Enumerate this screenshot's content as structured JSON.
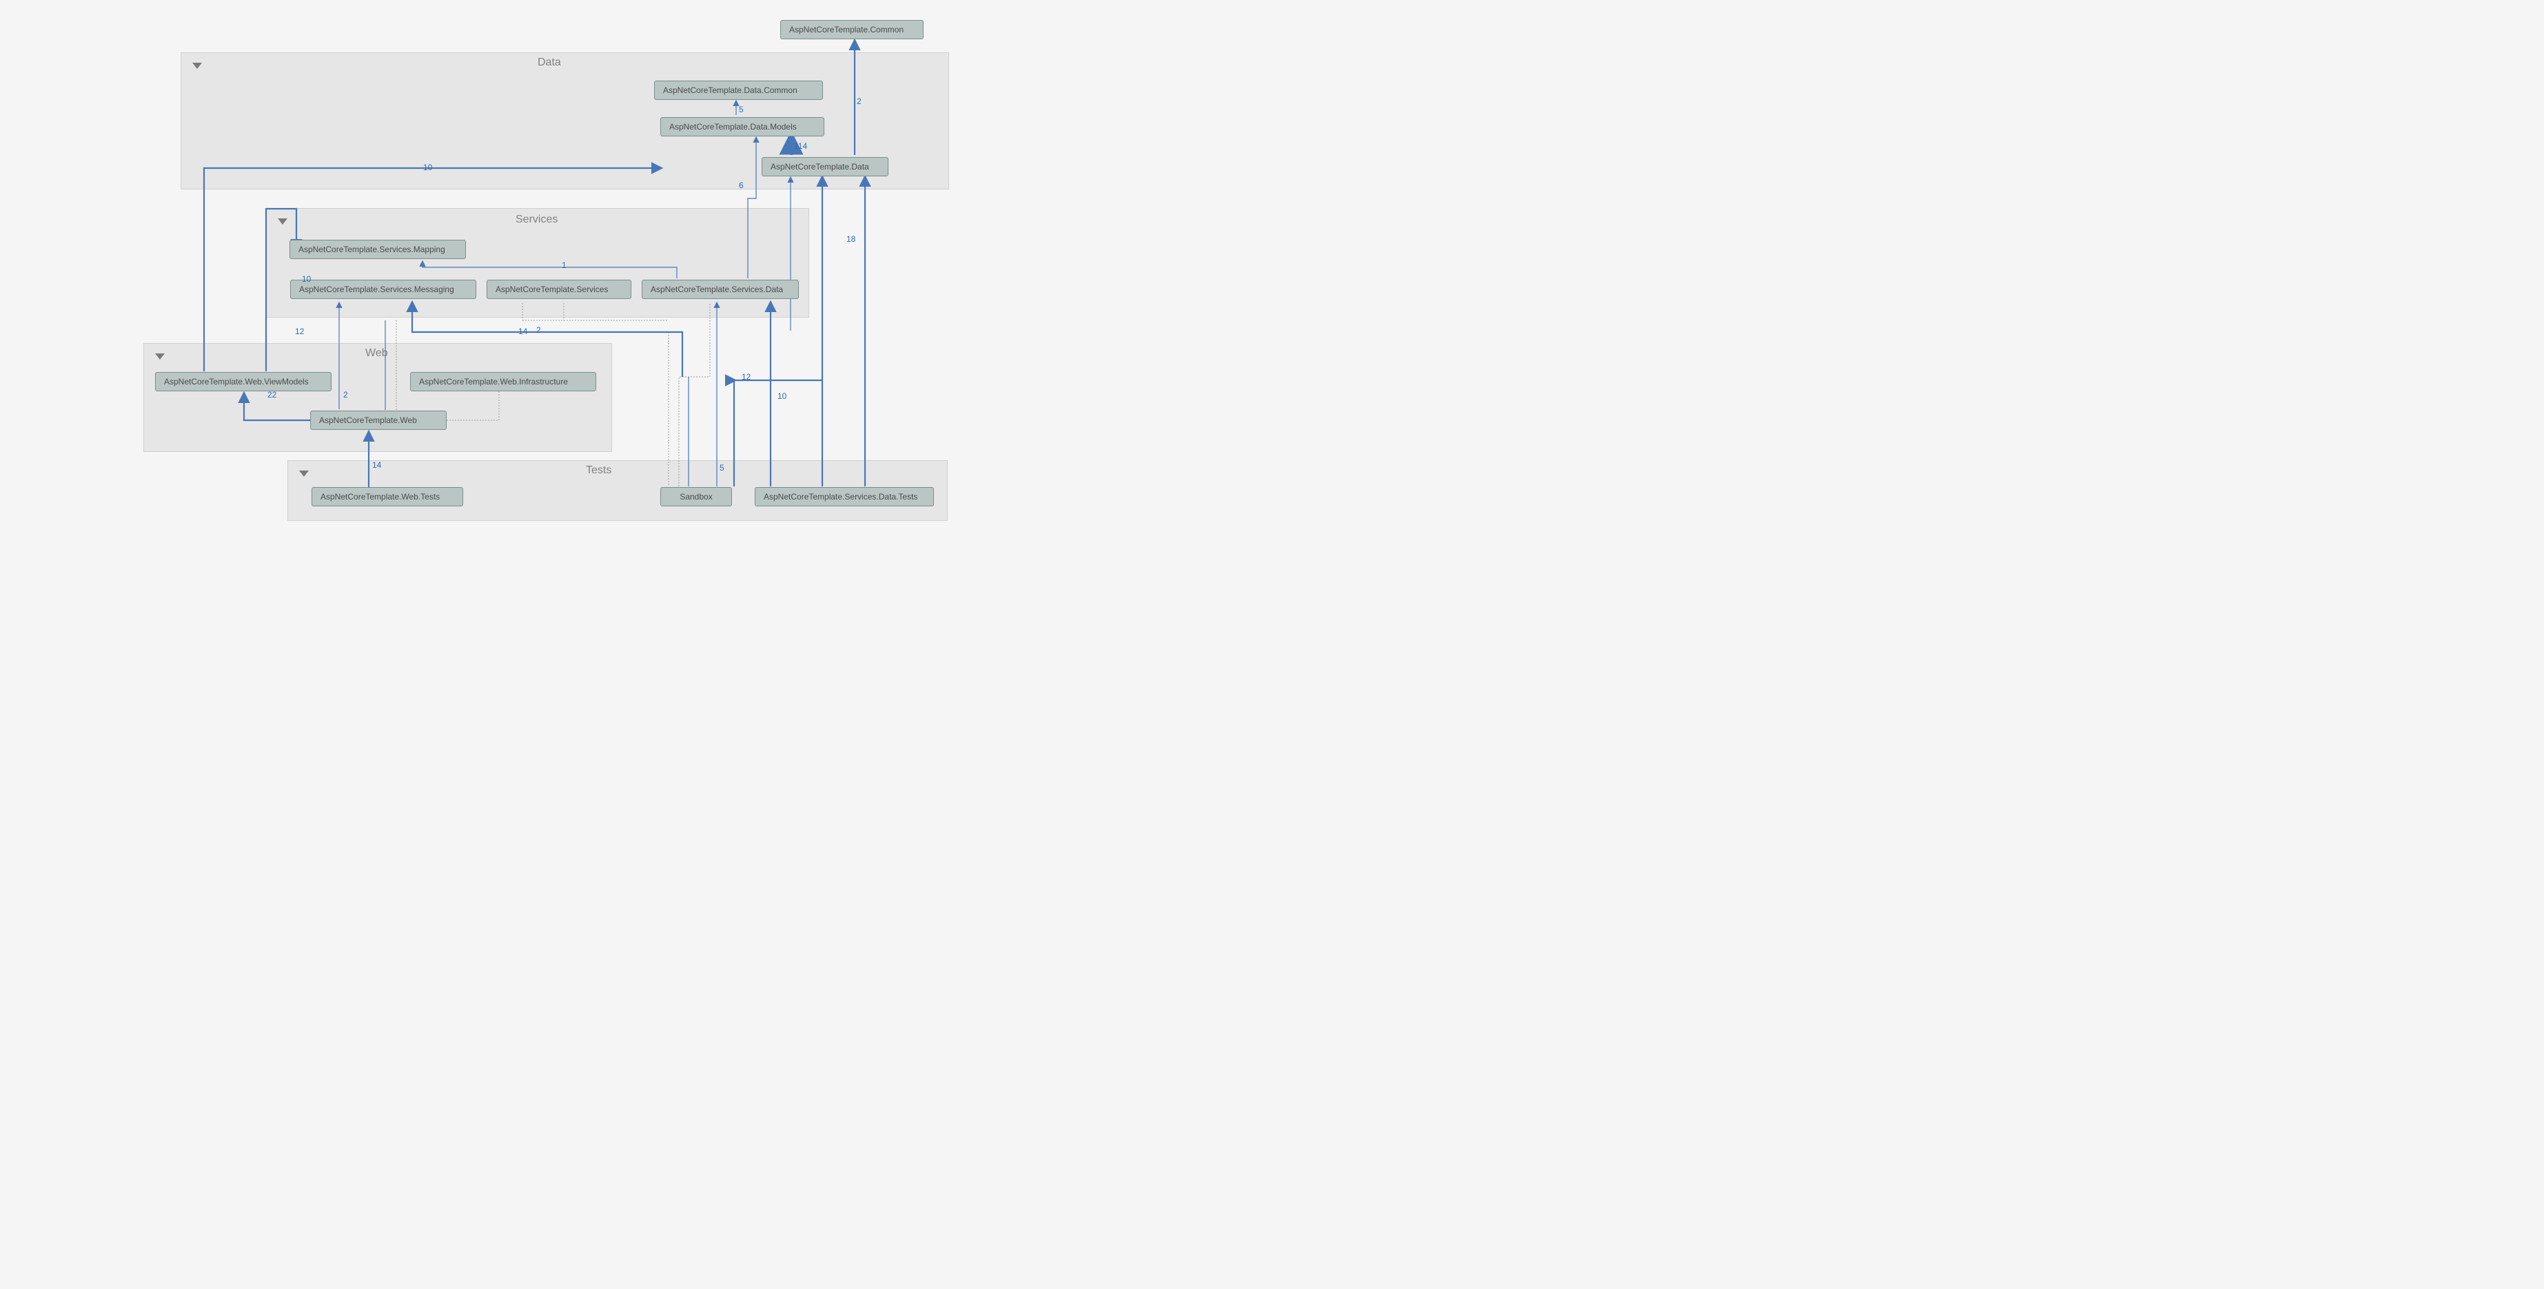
{
  "groups": {
    "data": {
      "title": "Data"
    },
    "services": {
      "title": "Services"
    },
    "web": {
      "title": "Web"
    },
    "tests": {
      "title": "Tests"
    }
  },
  "nodes": {
    "common": {
      "label": "AspNetCoreTemplate.Common"
    },
    "dataCommon": {
      "label": "AspNetCoreTemplate.Data.Common"
    },
    "dataModels": {
      "label": "AspNetCoreTemplate.Data.Models"
    },
    "data": {
      "label": "AspNetCoreTemplate.Data"
    },
    "svcMapping": {
      "label": "AspNetCoreTemplate.Services.Mapping"
    },
    "svcMessaging": {
      "label": "AspNetCoreTemplate.Services.Messaging"
    },
    "svc": {
      "label": "AspNetCoreTemplate.Services"
    },
    "svcData": {
      "label": "AspNetCoreTemplate.Services.Data"
    },
    "webViewModels": {
      "label": "AspNetCoreTemplate.Web.ViewModels"
    },
    "webInfra": {
      "label": "AspNetCoreTemplate.Web.Infrastructure"
    },
    "web": {
      "label": "AspNetCoreTemplate.Web"
    },
    "webTests": {
      "label": "AspNetCoreTemplate.Web.Tests"
    },
    "sandbox": {
      "label": "Sandbox"
    },
    "svcDataTests": {
      "label": "AspNetCoreTemplate.Services.Data.Tests"
    }
  },
  "edgeLabels": {
    "common_2": "2",
    "dataCommon_5": "5",
    "dataModels_114": "114",
    "dataModels_6": "6",
    "dataModels_10": "10",
    "data_18": "18",
    "data_12b": "12",
    "data_10b": "10",
    "svcMapping_1": "1",
    "svcMapping_10": "10",
    "svcMapping_2": "2",
    "svc_14": "14",
    "svc_12": "12",
    "vm_22": "22",
    "web_2": "2",
    "web_14": "14",
    "svcData_5": "5"
  }
}
